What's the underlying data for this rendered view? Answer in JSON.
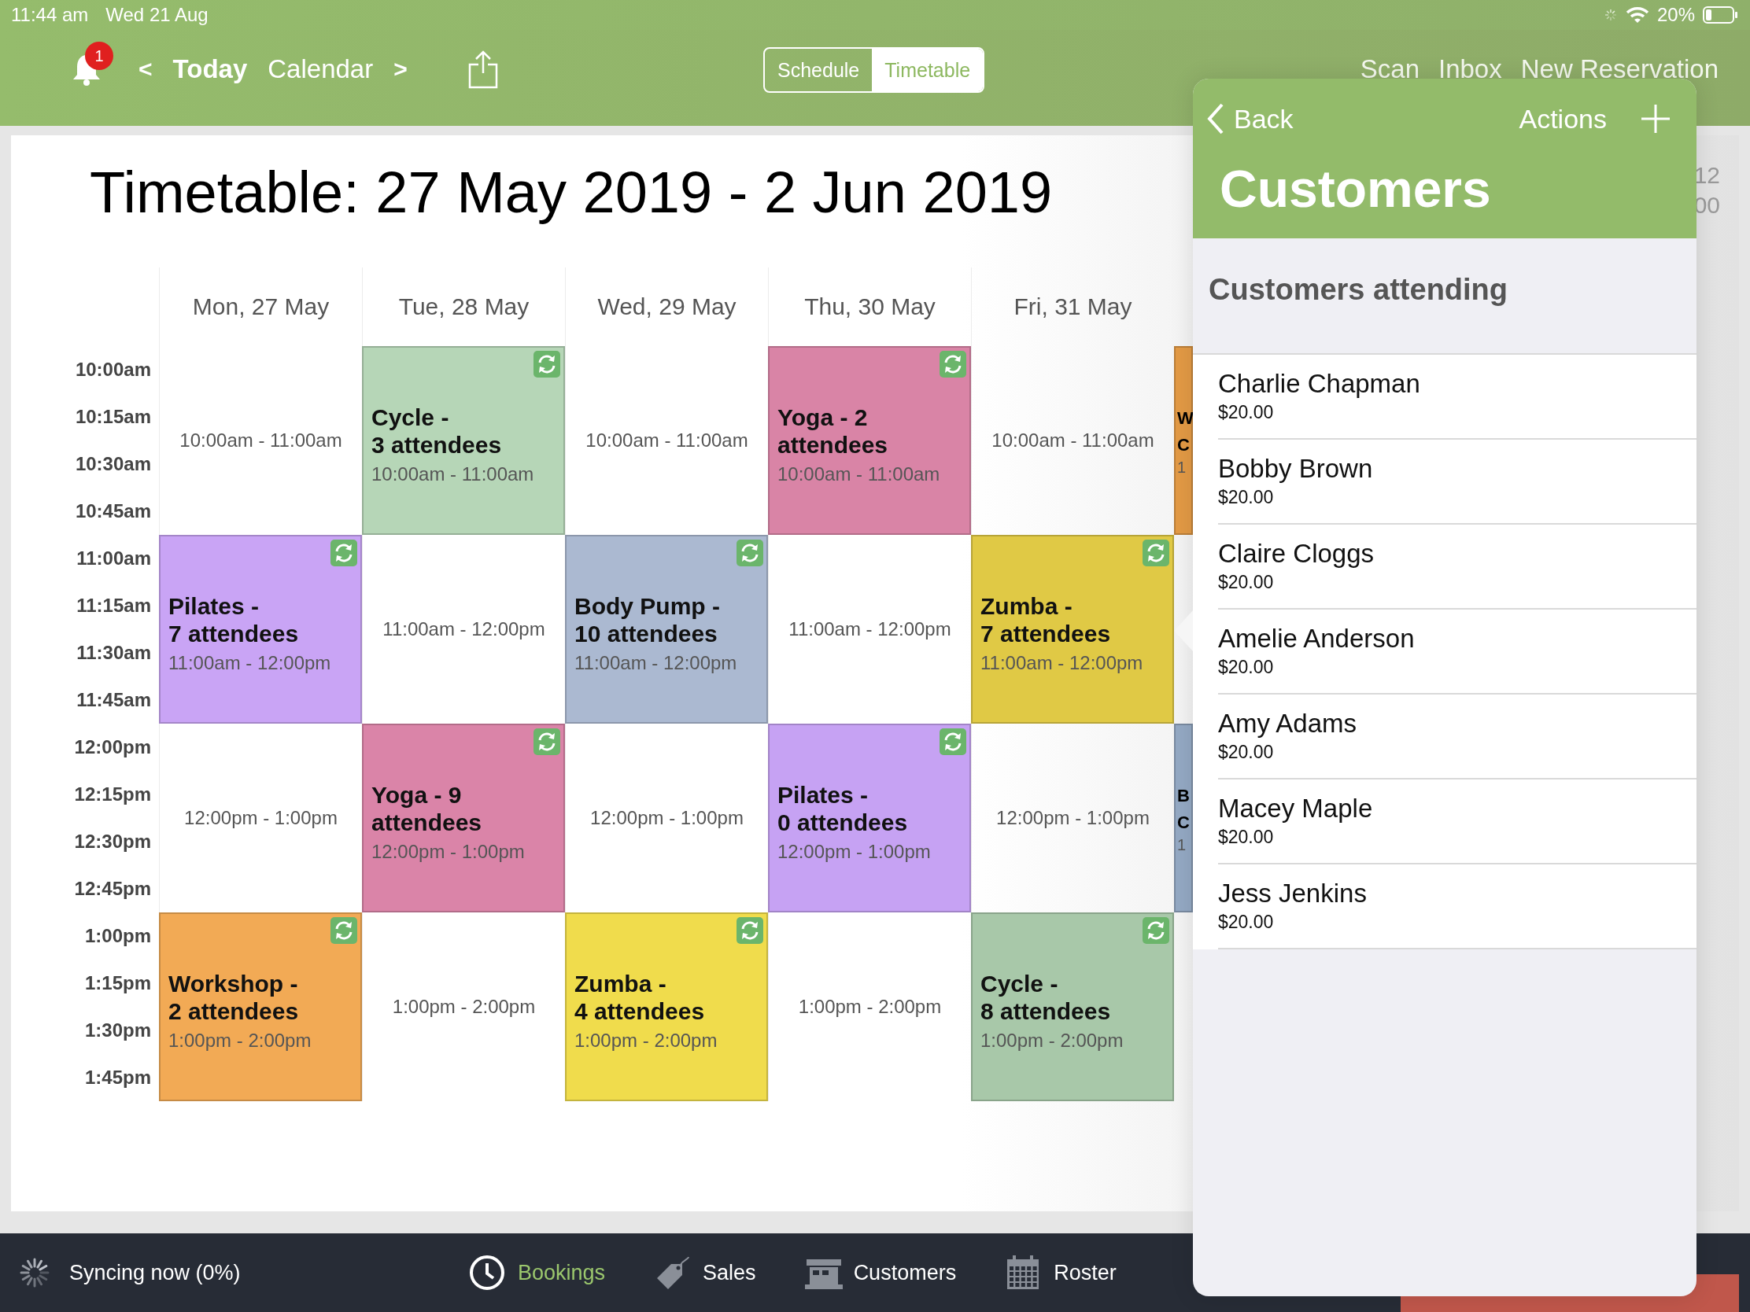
{
  "status_bar": {
    "time": "11:44 am",
    "date": "Wed 21 Aug",
    "battery": "20%"
  },
  "toolbar": {
    "notifications_badge": "1",
    "prev": "<",
    "today": "Today",
    "calendar": "Calendar",
    "next": ">",
    "segments": [
      {
        "label": "Schedule",
        "selected": false
      },
      {
        "label": "Timetable",
        "selected": true
      }
    ],
    "actions": [
      "Scan",
      "Inbox",
      "New Reservation"
    ]
  },
  "timetable": {
    "title": "Timetable: 27 May 2019 - 2 Jun 2019",
    "corner_fragments": [
      "12",
      "00"
    ],
    "times": [
      "10:00am",
      "10:15am",
      "10:30am",
      "10:45am",
      "11:00am",
      "11:15am",
      "11:30am",
      "11:45am",
      "12:00pm",
      "12:15pm",
      "12:30pm",
      "12:45pm",
      "1:00pm",
      "1:15pm",
      "1:30pm",
      "1:45pm"
    ],
    "days": [
      {
        "header": "Mon, 27 May",
        "slots": [
          {
            "kind": "free",
            "time": "10:00am - 11:00am"
          },
          {
            "kind": "event",
            "title": "Pilates -\n7 attendees",
            "time": "11:00am - 12:00pm",
            "color": "#c9a4f5",
            "recurring": true
          },
          {
            "kind": "free",
            "time": "12:00pm - 1:00pm"
          },
          {
            "kind": "event",
            "title": "Workshop -\n2 attendees",
            "time": "1:00pm - 2:00pm",
            "color": "#f2aa55",
            "recurring": true
          }
        ]
      },
      {
        "header": "Tue, 28 May",
        "slots": [
          {
            "kind": "event",
            "title": "Cycle -\n3 attendees",
            "time": "10:00am - 11:00am",
            "color": "#b6d6b7",
            "recurring": true
          },
          {
            "kind": "free",
            "time": "11:00am - 12:00pm"
          },
          {
            "kind": "event",
            "title": "Yoga - 9\nattendees",
            "time": "12:00pm - 1:00pm",
            "color": "#da84a8",
            "recurring": true
          },
          {
            "kind": "free",
            "time": "1:00pm - 2:00pm"
          }
        ]
      },
      {
        "header": "Wed, 29 May",
        "slots": [
          {
            "kind": "free",
            "time": "10:00am - 11:00am"
          },
          {
            "kind": "event",
            "title": "Body Pump -\n10 attendees",
            "time": "11:00am - 12:00pm",
            "color": "#abb9d1",
            "recurring": true
          },
          {
            "kind": "free",
            "time": "12:00pm - 1:00pm"
          },
          {
            "kind": "event",
            "title": "Zumba -\n4 attendees",
            "time": "1:00pm - 2:00pm",
            "color": "#f0dc4c",
            "recurring": true
          }
        ]
      },
      {
        "header": "Thu, 30 May",
        "slots": [
          {
            "kind": "event",
            "title": "Yoga - 2\nattendees",
            "time": "10:00am - 11:00am",
            "color": "#d984a6",
            "recurring": true
          },
          {
            "kind": "free",
            "time": "11:00am - 12:00pm"
          },
          {
            "kind": "event",
            "title": "Pilates -\n0 attendees",
            "time": "12:00pm - 1:00pm",
            "color": "#c6a2f3",
            "recurring": true
          },
          {
            "kind": "free",
            "time": "1:00pm - 2:00pm"
          }
        ]
      },
      {
        "header": "Fri, 31 May",
        "slots": [
          {
            "kind": "free",
            "time": "10:00am - 11:00am"
          },
          {
            "kind": "event",
            "title": "Zumba -\n7 attendees",
            "time": "11:00am - 12:00pm",
            "color": "#e0c945",
            "recurring": true
          },
          {
            "kind": "free",
            "time": "12:00pm - 1:00pm"
          },
          {
            "kind": "event",
            "title": "Cycle -\n8 attendees",
            "time": "1:00pm - 2:00pm",
            "color": "#a8c8a9",
            "recurring": true
          }
        ]
      }
    ],
    "partial_column": [
      {
        "kind": "event",
        "title": "W\nC",
        "time": "1",
        "color": "#e39a45"
      },
      {
        "kind": "free"
      },
      {
        "kind": "event",
        "title": "B\nC",
        "time": "1",
        "color": "#94a9c4"
      },
      {
        "kind": "free"
      }
    ]
  },
  "popover": {
    "back": "Back",
    "actions": "Actions",
    "title": "Customers",
    "section": "Customers attending",
    "customers": [
      {
        "name": "Charlie Chapman",
        "price": "$20.00"
      },
      {
        "name": "Bobby Brown",
        "price": "$20.00"
      },
      {
        "name": "Claire Cloggs",
        "price": "$20.00"
      },
      {
        "name": "Amelie Anderson",
        "price": "$20.00"
      },
      {
        "name": "Amy Adams",
        "price": "$20.00"
      },
      {
        "name": "Macey Maple",
        "price": "$20.00"
      },
      {
        "name": "Jess Jenkins",
        "price": "$20.00"
      }
    ]
  },
  "bottom_bar": {
    "sync": "Syncing now (0%)",
    "tabs": [
      {
        "label": "Bookings",
        "selected": true
      },
      {
        "label": "Sales",
        "selected": false
      },
      {
        "label": "Customers",
        "selected": false
      },
      {
        "label": "Roster",
        "selected": false
      }
    ]
  }
}
